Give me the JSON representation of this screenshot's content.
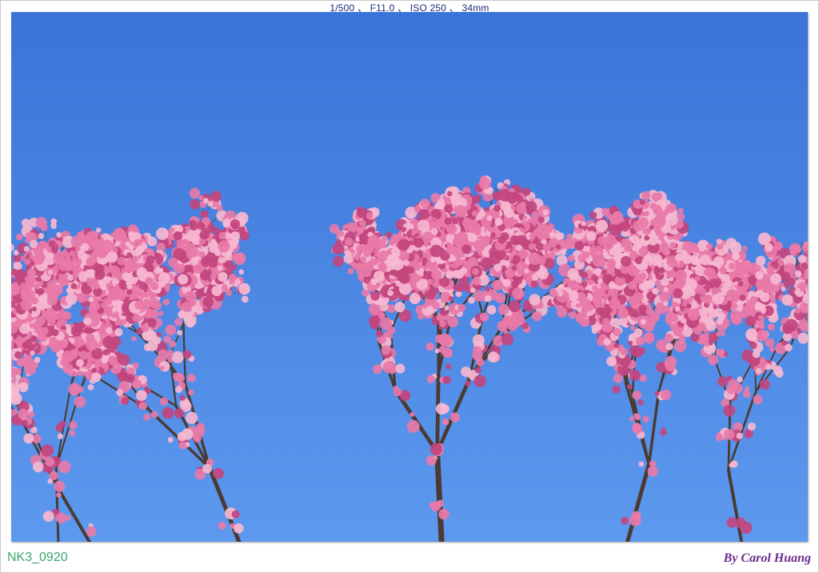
{
  "header": {
    "exif": "1/500 、 F11.0 、 ISO 250 、 34mm"
  },
  "photo": {
    "subject": "pink cherry blossom branches against blue sky",
    "colors": {
      "sky_top": "#3a74d8",
      "sky_bottom": "#5d99ee",
      "blossom": "#e87aa8",
      "blossom_light": "#f6b7d0",
      "blossom_dark": "#c2457e",
      "branch": "#4a3a32"
    }
  },
  "footer": {
    "file_id": "NK3_0920",
    "credit": "By Carol Huang"
  }
}
